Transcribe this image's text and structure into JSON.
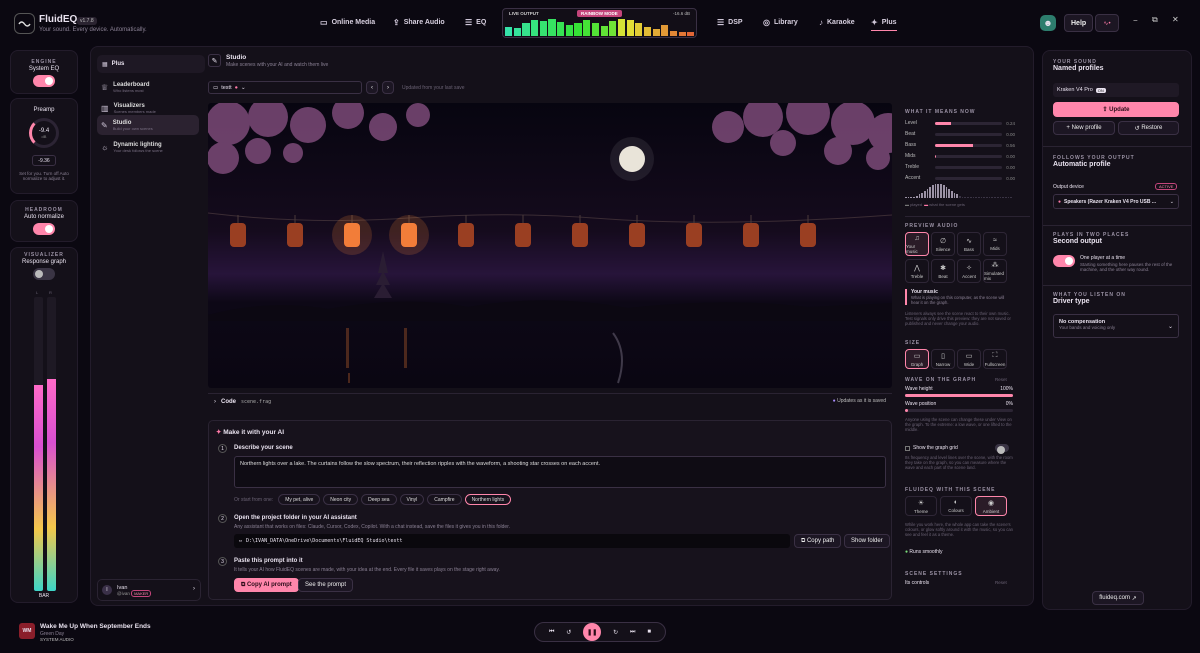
{
  "app": {
    "name": "FluidEQ",
    "version": "v1.7.8",
    "tagline": "Your sound. Every device. Automatically."
  },
  "topnav": [
    {
      "label": "Online Media",
      "icon": "monitor-icon"
    },
    {
      "label": "Share Audio",
      "icon": "share-icon"
    },
    {
      "label": "EQ",
      "icon": "sliders-icon"
    },
    {
      "label": "DSP",
      "icon": "sliders-icon"
    },
    {
      "label": "Library",
      "icon": "disc-icon"
    },
    {
      "label": "Karaoke",
      "icon": "mic-icon"
    },
    {
      "label": "Plus",
      "icon": "sparkle-icon"
    }
  ],
  "live": {
    "label": "LIVE OUTPUT",
    "mode": "RAINBOW MODE",
    "db": "-16.6 dB",
    "levels": [
      0.5,
      0.45,
      0.7,
      0.9,
      0.85,
      0.95,
      0.8,
      0.6,
      0.75,
      0.9,
      0.7,
      0.55,
      0.85,
      0.95,
      0.9,
      0.7,
      0.5,
      0.4,
      0.6,
      0.3,
      0.25,
      0.2
    ]
  },
  "header_right": {
    "help": "Help"
  },
  "left": {
    "engine_title": "ENGINE",
    "engine_label": "System EQ",
    "preamp_title": "Preamp",
    "preamp_knob": "-9.4",
    "preamp_unit": "dB",
    "preamp_value": "-9.36",
    "preamp_note": "Set for you. Turn off Auto normalize to adjust it.",
    "headroom_title": "HEADROOM",
    "headroom_label": "Auto normalize",
    "visualizer_title": "VISUALIZER",
    "visualizer_label": "Response graph",
    "meter_l": "L",
    "meter_r": "R",
    "meter_foot": "BAR",
    "meter_l_level": 0.7,
    "meter_r_level": 0.72
  },
  "sidebar": {
    "header": "Plus",
    "items": [
      {
        "title": "Leaderboard",
        "sub": "Who listens most",
        "icon": "trophy-icon"
      },
      {
        "title": "Visualizers",
        "sub": "Scenes members made",
        "icon": "bars-icon"
      },
      {
        "title": "Studio",
        "sub": "Build your own scenes",
        "icon": "pen-icon"
      },
      {
        "title": "Dynamic lighting",
        "sub": "Your desk follows the scene",
        "icon": "bulb-icon"
      }
    ],
    "user_name": "Ivan",
    "user_handle": "@ivan",
    "user_badge": "MAKER"
  },
  "studio": {
    "title": "Studio",
    "subtitle": "Make scenes with your AI and watch them live",
    "file": "testt",
    "updated": "Updated from your last save",
    "code_label": "Code",
    "code_file": "scene.frag",
    "code_status": "Updates as it is saved",
    "ai_title": "Make it with your AI",
    "step1_title": "Describe your scene",
    "step1_text": "Northern lights over a lake. The curtains follow the slow spectrum, their reflection ripples with the waveform, a shooting star crosses on each accent.",
    "chips_lead": "Or start from one:",
    "chips": [
      "My pet, alive",
      "Neon city",
      "Deep sea",
      "Vinyl",
      "Campfire",
      "Northern lights"
    ],
    "step2_title": "Open the project folder in your AI assistant",
    "step2_sub": "Any assistant that works on files: Claude, Cursor, Codex, Copilot. With a chat instead, save the files it gives you in this folder.",
    "path": "D:\\IVAN_DATA\\OneDrive\\Documents\\FluidEQ Studio\\testt",
    "copy_path": "Copy path",
    "show_folder": "Show folder",
    "step3_title": "Paste this prompt into it",
    "step3_sub": "It tells your AI how FluidEQ scenes are made, with your idea at the end. Every file it saves plays on the stage right away.",
    "copy_prompt": "Copy AI prompt",
    "see_prompt": "See the prompt",
    "n1": "1",
    "n2": "2",
    "n3": "3"
  },
  "inspector": {
    "means_title": "WHAT IT MEANS NOW",
    "meters": [
      {
        "name": "Level",
        "v": "0.24",
        "f": 0.24
      },
      {
        "name": "Beat",
        "v": "0.00",
        "f": 0.0
      },
      {
        "name": "Bass",
        "v": "0.56",
        "f": 0.56
      },
      {
        "name": "Mids",
        "v": "0.00",
        "f": 0.02
      },
      {
        "name": "Treble",
        "v": "0.00",
        "f": 0.0
      },
      {
        "name": "Accent",
        "v": "0.00",
        "f": 0.0
      }
    ],
    "legend_played": "played",
    "legend_scene": "what the scene gets",
    "preview_title": "PREVIEW AUDIO",
    "tiles": [
      "Your music",
      "Silence",
      "Bass",
      "Mids",
      "Treble",
      "Beat",
      "Accent",
      "Simulated mix"
    ],
    "music_title": "Your music",
    "music_sub": "What is playing on this computer, as the scene will hear it on the graph.",
    "music_note": "Listeners always see the scene react to their own music. Test signals only drive this preview: they are not saved or published and never change your audio.",
    "size_title": "SIZE",
    "sizes": [
      "Graph",
      "Narrow",
      "Wide",
      "Fullscreen"
    ],
    "wave_title": "WAVE ON THE GRAPH",
    "reset": "Reset",
    "wave_height": "Wave height",
    "wave_height_v": "100%",
    "wave_height_f": 1.0,
    "wave_pos": "Wave position",
    "wave_pos_v": "0%",
    "wave_pos_f": 0.0,
    "wave_note": "Anyone using the scene can change these under View on the graph. To the extreme: a low wave, or one lifted to the middle.",
    "grid_label": "Show the graph grid",
    "grid_note": "Its frequency and level lines over the scene, with the room they take on the graph, so you can measure where the wave and each part of the scene land.",
    "fluid_title": "FLUIDEQ WITH THIS SCENE",
    "fluid_tiles": [
      "Theme",
      "Colours",
      "Ambient"
    ],
    "fluid_note": "While you work here, the whole app can take the scene's colours, or glow softly around it with the music, so you can see and feel it as a theme.",
    "smooth": "Runs smoothly",
    "settings_title": "SCENE SETTINGS",
    "controls": "Its controls",
    "controls_reset": "Reset"
  },
  "right": {
    "sound_title": "YOUR SOUND",
    "sound_heading": "Named profiles",
    "profile": "Kraken V4 Pro",
    "profile_badge": "ON",
    "update": "Update",
    "new_profile": "New profile",
    "restore": "Restore",
    "follow_title": "FOLLOWS YOUR OUTPUT",
    "follow_heading": "Automatic profile",
    "output_label": "Output device",
    "active": "ACTIVE",
    "device": "Speakers (Razer Kraken V4 Pro USB ...",
    "two_title": "PLAYS IN TWO PLACES",
    "two_heading": "Second output",
    "two_label": "One player at a time",
    "two_sub": "Starting something here pauses the rest of the machine, and the other way round.",
    "driver_title": "WHAT YOU LISTEN ON",
    "driver_heading": "Driver type",
    "comp": "No compensation",
    "comp_sub": "Your bands and voicing only",
    "site": "fluideq.com"
  },
  "player": {
    "art": "WM",
    "song": "Wake Me Up When September Ends",
    "artist": "Green Day",
    "source": "SYSTEM AUDIO"
  },
  "colors": {
    "accent": "#ff86ab",
    "bg": "#0b0811",
    "panel": "#141019"
  }
}
